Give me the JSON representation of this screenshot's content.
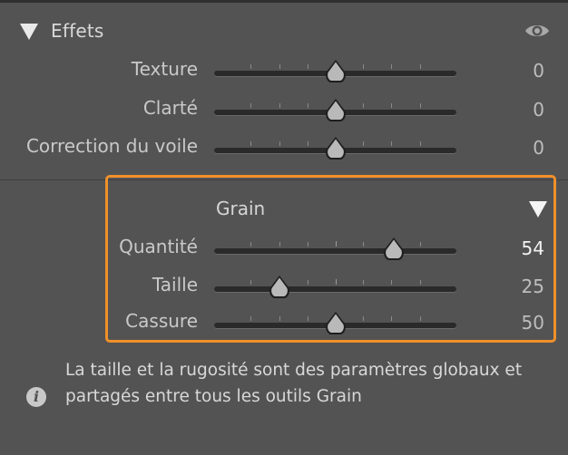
{
  "panel": {
    "title": "Effets"
  },
  "effects": [
    {
      "label": "Texture",
      "value": "0",
      "position": 0.5
    },
    {
      "label": "Clarté",
      "value": "0",
      "position": 0.5
    },
    {
      "label": "Correction du voile",
      "value": "0",
      "position": 0.5
    }
  ],
  "grain": {
    "title": "Grain",
    "highlight_color": "#f0902a",
    "rows": [
      {
        "label": "Quantité",
        "value": "54",
        "position": 0.74
      },
      {
        "label": "Taille",
        "value": "25",
        "position": 0.27
      },
      {
        "label": "Cassure",
        "value": "50",
        "position": 0.5
      }
    ]
  },
  "info": {
    "text": "La taille et la rugosité sont des paramètres globaux et partagés entre tous les outils Grain"
  },
  "icons": {
    "collapse": "triangle-down-icon",
    "visibility": "eye-icon",
    "grain_collapse": "triangle-down-icon",
    "info": "info-icon"
  }
}
